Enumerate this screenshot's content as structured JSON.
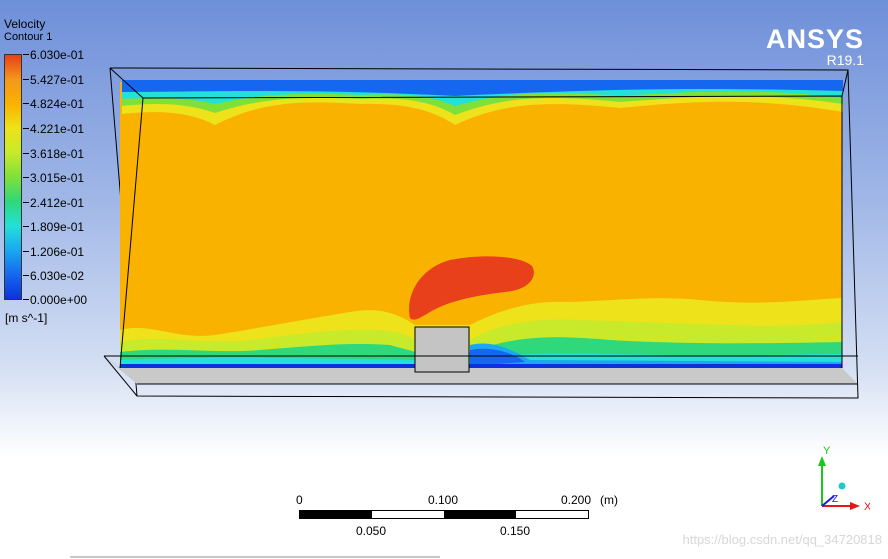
{
  "legend": {
    "title": "Velocity",
    "subtitle": "Contour 1",
    "unit": "[m s^-1]",
    "values": [
      "6.030e-01",
      "5.427e-01",
      "4.824e-01",
      "4.221e-01",
      "3.618e-01",
      "3.015e-01",
      "2.412e-01",
      "1.809e-01",
      "1.206e-01",
      "6.030e-02",
      "0.000e+00"
    ],
    "colors": [
      "#e8401a",
      "#f5961b",
      "#f9b200",
      "#eee21a",
      "#c8ea2a",
      "#7fe03a",
      "#2fd87a",
      "#23e0d8",
      "#1aa8f0",
      "#1667f0",
      "#0b32dc"
    ]
  },
  "logo": {
    "brand": "ANSYS",
    "version": "R19.1"
  },
  "scale": {
    "top_labels": [
      "0",
      "0.100",
      "0.200"
    ],
    "bottom_labels": [
      "0.050",
      "0.150"
    ],
    "unit": "(m)"
  },
  "axes": {
    "y": "Y",
    "z": "Z",
    "x": "X"
  },
  "watermark": "https://blog.csdn.net/qq_34720818"
}
